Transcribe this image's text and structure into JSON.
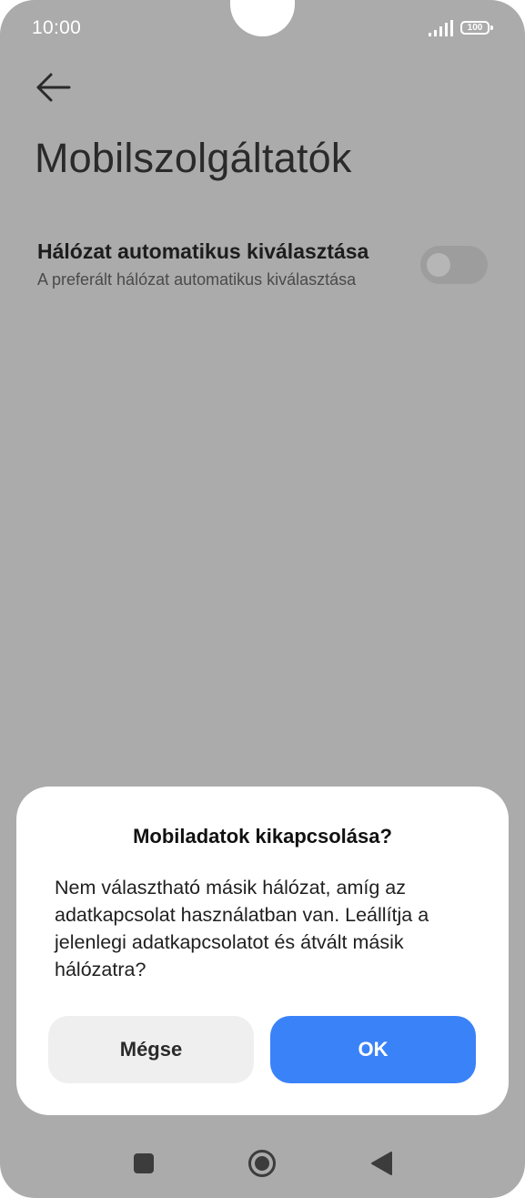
{
  "status_bar": {
    "time": "10:00",
    "battery": "100",
    "signal_icon": "signal-bars-icon"
  },
  "header": {
    "back_icon": "arrow-left-icon",
    "title": "Mobilszolgáltatók"
  },
  "setting": {
    "title": "Hálózat automatikus kiválasztása",
    "subtitle": "A preferált hálózat automatikus kiválasztása",
    "toggle_state": "off"
  },
  "dialog": {
    "title": "Mobiladatok kikapcsolása?",
    "body": "Nem választható másik hálózat, amíg az adatkapcsolat használatban van. Leállítja a jelenlegi adatkapcsolatot és átvált másik hálózatra?",
    "cancel_label": "Mégse",
    "ok_label": "OK"
  },
  "nav_bar": {
    "recents_icon": "square-icon",
    "home_icon": "circle-home-icon",
    "back_icon": "triangle-back-icon"
  },
  "colors": {
    "overlay": "#ababab",
    "accent": "#3a82f7",
    "dialog_bg": "#ffffff",
    "cancel_bg": "#efefef"
  }
}
